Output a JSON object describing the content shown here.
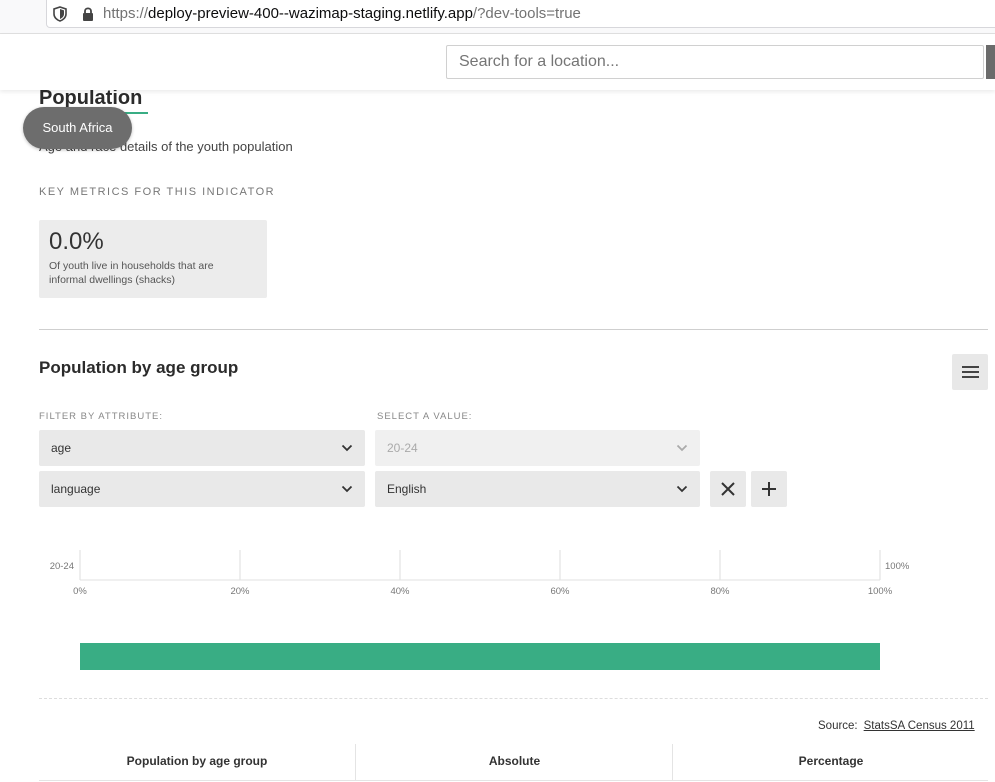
{
  "browser": {
    "url_scheme": "https://",
    "url_host": "deploy-preview-400--wazimap-staging.netlify.app",
    "url_path": "/?dev-tools=true"
  },
  "header": {
    "search_placeholder": "Search for a location..."
  },
  "location_pill": "South Africa",
  "page": {
    "title": "Population",
    "subtitle": "Age and race details of the youth population"
  },
  "metrics": {
    "label": "KEY METRICS FOR THIS INDICATOR",
    "items": [
      {
        "value": "0.0%",
        "description": "Of youth live in households that are informal dwellings (shacks)"
      }
    ]
  },
  "section": {
    "title": "Population by age group",
    "filter_attribute_label": "FILTER BY ATTRIBUTE:",
    "select_value_label": "SELECT A VALUE:",
    "filters": [
      {
        "attribute": "age",
        "value": "20-24",
        "value_disabled": true
      },
      {
        "attribute": "language",
        "value": "English",
        "value_disabled": false
      }
    ]
  },
  "chart_data": {
    "type": "bar",
    "orientation": "horizontal",
    "categories": [
      "20-24"
    ],
    "values": [
      100
    ],
    "value_labels": [
      "100%"
    ],
    "x_ticks": [
      "0%",
      "20%",
      "40%",
      "60%",
      "80%",
      "100%"
    ],
    "xlim": [
      0,
      100
    ],
    "grid": true
  },
  "source": {
    "label": "Source:",
    "link_text": "StatsSA Census 2011"
  },
  "table": {
    "headers": [
      "Population by age group",
      "Absolute",
      "Percentage"
    ]
  },
  "colors": {
    "accent": "#39ad84",
    "location_pill": "#6d6d6d"
  }
}
